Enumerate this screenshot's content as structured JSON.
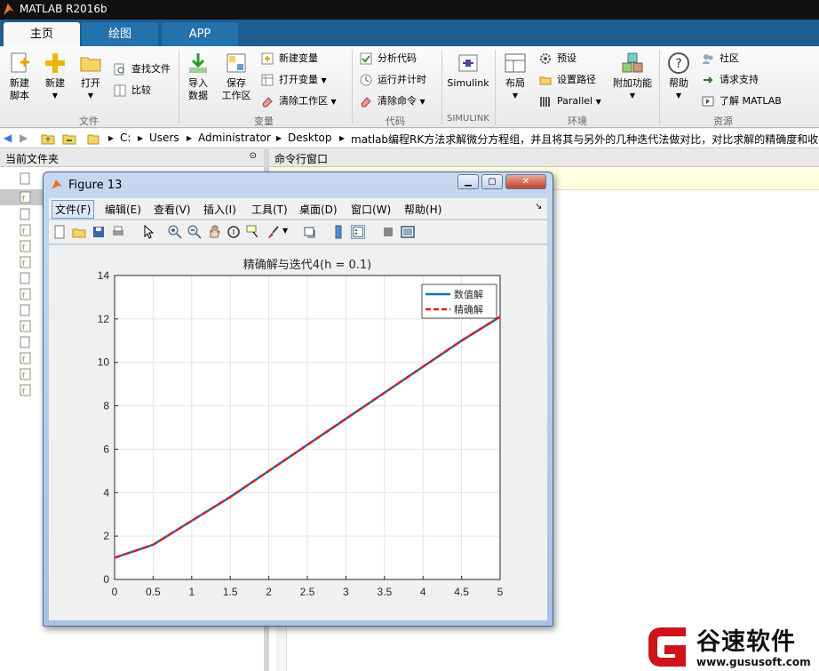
{
  "window": {
    "title": "MATLAB R2016b"
  },
  "tabs": [
    {
      "label": "主页"
    },
    {
      "label": "绘图"
    },
    {
      "label": "APP"
    }
  ],
  "ribbon": {
    "new_script": "新建\n脚本",
    "new": "新建",
    "open": "打开",
    "find_files": "查找文件",
    "compare": "比较",
    "import_data": "导入\n数据",
    "save_workspace": "保存\n工作区",
    "new_variable": "新建变量",
    "open_variable": "打开变量",
    "clear_workspace": "清除工作区",
    "analyze_code": "分析代码",
    "run_and_time": "运行并计时",
    "clear_commands": "清除命令",
    "simulink": "Simulink",
    "layout": "布局",
    "preferences": "预设",
    "set_path": "设置路径",
    "parallel": "Parallel",
    "addons": "附加功能",
    "help": "帮助",
    "community": "社区",
    "request_support": "请求支持",
    "learn_matlab": "了解 MATLAB",
    "groups": {
      "file": "文件",
      "variable": "变量",
      "code": "代码",
      "simulink": "SIMULINK",
      "environment": "环境",
      "resources": "资源"
    }
  },
  "address": {
    "segments": [
      "C:",
      "Users",
      "Administrator",
      "Desktop",
      "matlab编程RK方法求解微分方程组，并且将其与另外的几种迭代法做对比，对比求解的精确度和收敛"
    ]
  },
  "left_panel": {
    "title": "当前文件夹"
  },
  "right_panel": {
    "title": "命令行窗口"
  },
  "figure": {
    "title": "Figure 13",
    "menu": [
      "文件(F)",
      "编辑(E)",
      "查看(V)",
      "插入(I)",
      "工具(T)",
      "桌面(D)",
      "窗口(W)",
      "帮助(H)"
    ]
  },
  "watermark": {
    "name": "谷速软件",
    "url": "www.gususoft.com"
  },
  "chart_data": {
    "type": "line",
    "title": "精确解与迭代4(h = 0.1)",
    "xlabel": "",
    "ylabel": "",
    "xlim": [
      0,
      5
    ],
    "ylim": [
      0,
      14
    ],
    "xticks": [
      "0",
      "0.5",
      "1",
      "1.5",
      "2",
      "2.5",
      "3",
      "3.5",
      "4",
      "4.5",
      "5"
    ],
    "yticks": [
      "0",
      "2",
      "4",
      "6",
      "8",
      "10",
      "12",
      "14"
    ],
    "grid": true,
    "legend_position": "top-right",
    "x": [
      0,
      0.5,
      1,
      1.5,
      2,
      2.5,
      3,
      3.5,
      4,
      4.5,
      5
    ],
    "series": [
      {
        "name": "数值解",
        "color": "#0072bd",
        "style": "solid",
        "values": [
          1.0,
          1.6,
          2.7,
          3.8,
          5.0,
          6.2,
          7.4,
          8.6,
          9.8,
          11.0,
          12.1
        ]
      },
      {
        "name": "精确解",
        "color": "#e41a1c",
        "style": "dashed",
        "values": [
          1.0,
          1.6,
          2.7,
          3.8,
          5.0,
          6.2,
          7.4,
          8.6,
          9.8,
          11.0,
          12.1
        ]
      }
    ]
  }
}
